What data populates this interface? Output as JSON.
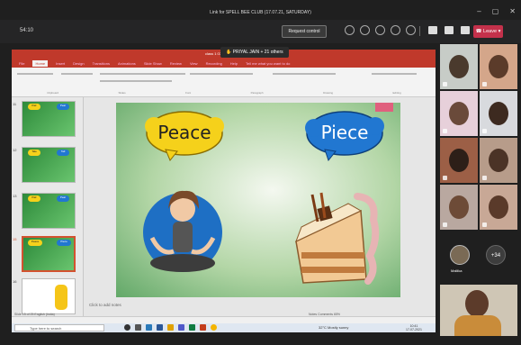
{
  "window": {
    "title": "Link for SPELL BEE CLUB (17.07.21, SATURDAY)"
  },
  "meeting": {
    "timer": "54:10",
    "request_control": "Request control",
    "leave": "Leave"
  },
  "ppt": {
    "filename": "class 1 07.21",
    "share_notice": "PRIYAL JAIN + 21 others",
    "tabs": [
      "File",
      "Home",
      "Insert",
      "Design",
      "Transitions",
      "Animations",
      "Slide Show",
      "Review",
      "View",
      "Recording",
      "Help",
      "Tell me what you want to do"
    ],
    "ribbon_groups": [
      "Clipboard",
      "Slides",
      "Font",
      "Paragraph",
      "Drawing",
      "Editing"
    ],
    "notes_placeholder": "Click to add notes",
    "status_left": "Slide 15 of 25",
    "status_lang": "English (India)",
    "status_right": "Notes  Comments",
    "zoom": "65%"
  },
  "slide": {
    "left_word": "Peace",
    "right_word": "Piece"
  },
  "thumbnails": [
    {
      "num": "11",
      "a": "Pair",
      "b": "Pear"
    },
    {
      "num": "12",
      "a": "Tale",
      "b": "Tail"
    },
    {
      "num": "13",
      "a": "Pair",
      "b": "Pear"
    },
    {
      "num": "15",
      "a": "Peace",
      "b": "Piece"
    },
    {
      "num": "16",
      "a": "",
      "b": ""
    }
  ],
  "taskbar": {
    "search": "Type here to search",
    "weather": "32°C  Mostly sunny",
    "time": "10:41",
    "date": "17-07-2021"
  },
  "participants": {
    "avatar_name": "Mallika",
    "more_count": "+34"
  },
  "colors": {
    "ppt_red": "#c0392b",
    "leave_red": "#c4314b",
    "peace_bubble": "#f5d11b",
    "piece_bubble": "#2177d1"
  }
}
